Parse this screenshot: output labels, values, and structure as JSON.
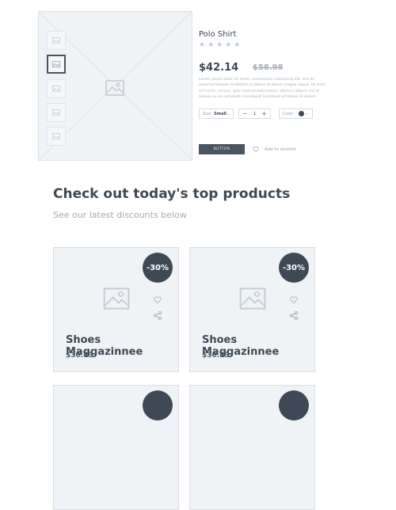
{
  "product": {
    "name": "Polo Shirt",
    "rating": "★★★★★",
    "price": "$42.14",
    "old_price": "$58.98",
    "description": "Lorem ipsum dolor sit amet, consectetur adipisicing elit, sed do eiusmod tempor incididunt ut labore et dolore magna aliqua. Ut enim ad minim veniam, quis nostrud exercitation ullamco laboris nisi ut aliquip ex ea commodo consequat incididunt ut labore et dolore.",
    "size_label": "Size",
    "size_value": "Small",
    "quantity": "1",
    "color_label": "Color",
    "color_value": "#3f4956",
    "button_label": "BUTTON",
    "wishlist_label": "Add to wishlist"
  },
  "section": {
    "title": "Check out today's top products",
    "subtitle": "See our latest discounts below"
  },
  "cards": [
    {
      "badge": "-30%",
      "title": "Shoes Maggazinnee",
      "price": "$30.43"
    },
    {
      "badge": "-30%",
      "title": "Shoes Maggazinnee",
      "price": "$30.43"
    }
  ],
  "icons": {
    "image": "image-placeholder-icon",
    "heart": "heart-icon",
    "share": "share-icon",
    "chevron": "chevron-down-icon"
  }
}
